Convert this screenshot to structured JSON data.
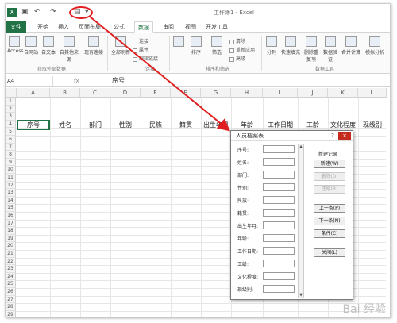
{
  "titlebar": {
    "file_title": "工作簿1 - Excel",
    "qa_icons": [
      "save-icon",
      "undo-icon",
      "redo-icon",
      "form-icon",
      "customize-icon"
    ]
  },
  "tabs": [
    "文件",
    "开始",
    "插入",
    "页面布局",
    "公式",
    "数据",
    "审阅",
    "视图",
    "开发工具"
  ],
  "active_tab": "数据",
  "ribbon": {
    "get_external": [
      "Access",
      "自网站",
      "自文本",
      "自其他来源",
      "现有连接"
    ],
    "get_external_label": "获取外部数据",
    "refresh": "全部刷新",
    "conn_items": [
      "连接",
      "属性",
      "编辑链接"
    ],
    "conn_label": "连接",
    "sort_items": [
      "排序",
      "筛选"
    ],
    "filter_items": [
      "清除",
      "重新应用",
      "高级"
    ],
    "sort_label": "排序和筛选",
    "tools": [
      "分列",
      "快速填充",
      "删除重复项",
      "数据验证",
      "合并计算",
      "模拟分析"
    ],
    "tools_label": "数据工具"
  },
  "formula_bar": {
    "name_box": "A4",
    "fx": "fx",
    "value": "序号"
  },
  "columns": [
    "A",
    "B",
    "C",
    "D",
    "E",
    "F",
    "G",
    "H",
    "I",
    "J",
    "K",
    "L"
  ],
  "rows": [
    "1",
    "2",
    "3",
    "4",
    "5",
    "6",
    "7",
    "8",
    "9",
    "10",
    "11",
    "12",
    "13",
    "14",
    "15",
    "16",
    "17",
    "18",
    "19",
    "20",
    "21",
    "22",
    "23",
    "24",
    "25",
    "26",
    "27",
    "28",
    "29"
  ],
  "headers": [
    "序号",
    "姓名",
    "部门",
    "性别",
    "民族",
    "籍贯",
    "出生年月",
    "年龄",
    "工作日期",
    "工龄",
    "文化程度",
    "现级别"
  ],
  "dialog": {
    "title": "人员档案表",
    "help": "?",
    "close": "×",
    "fields": [
      "序号:",
      "姓名:",
      "部门:",
      "性别:",
      "民族:",
      "籍贯:",
      "出生年月:",
      "年龄:",
      "工作日期:",
      "工龄:",
      "文化程度:",
      "现级别:"
    ],
    "record_label": "新建记录",
    "buttons": [
      {
        "label": "新建(W)",
        "disabled": false
      },
      {
        "label": "删除(D)",
        "disabled": true
      },
      {
        "label": "还原(R)",
        "disabled": true
      },
      {
        "label": "上一条(P)",
        "disabled": false
      },
      {
        "label": "下一条(N)",
        "disabled": false
      },
      {
        "label": "条件(C)",
        "disabled": false
      },
      {
        "label": "关闭(L)",
        "disabled": false
      }
    ]
  },
  "watermark": "Bai 经验",
  "colors": {
    "excel_green": "#217346",
    "arrow_red": "#e02020"
  }
}
